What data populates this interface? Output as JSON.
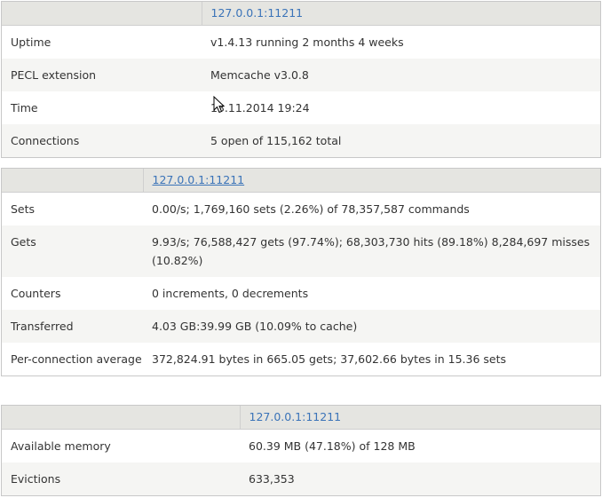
{
  "panels": [
    {
      "header": {
        "server": "127.0.0.1:11211"
      },
      "rows": [
        {
          "label": "Uptime",
          "value": "v1.4.13 running 2 months 4 weeks"
        },
        {
          "label": "PECL extension",
          "value": "Memcache v3.0.8"
        },
        {
          "label": "Time",
          "value": "13.11.2014 19:24"
        },
        {
          "label": "Connections",
          "value": "5 open of 115,162 total"
        }
      ]
    },
    {
      "header": {
        "server": "127.0.0.1:11211"
      },
      "rows": [
        {
          "label": "Sets",
          "value": "0.00/s; 1,769,160 sets (2.26%) of 78,357,587 commands"
        },
        {
          "label": "Gets",
          "value": "9.93/s; 76,588,427 gets (97.74%); 68,303,730 hits (89.18%) 8,284,697 misses (10.82%)"
        },
        {
          "label": "Counters",
          "value": "0 increments, 0 decrements"
        },
        {
          "label": "Transferred",
          "value": "4.03 GB:39.99 GB (10.09% to cache)"
        },
        {
          "label": "Per-connection average",
          "value": "372,824.91 bytes in 665.05 gets; 37,602.66 bytes in 15.36 sets"
        }
      ]
    },
    {
      "header": {
        "server": "127.0.0.1:11211"
      },
      "rows": [
        {
          "label": "Available memory",
          "value": "60.39 MB (47.18%) of 128 MB"
        },
        {
          "label": "Evictions",
          "value": "633,353"
        }
      ]
    }
  ],
  "colors": {
    "header_bg": "#e5e5e1",
    "stripe_bg": "#f5f5f3",
    "link": "#3a73b8",
    "border": "#c8c8c8"
  }
}
